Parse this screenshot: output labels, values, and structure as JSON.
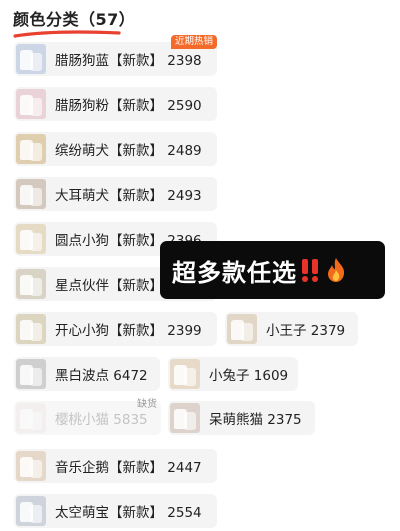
{
  "header": {
    "title": "颜色分类（57）"
  },
  "options": [
    {
      "label": "腊肠狗蓝【新款】 2398",
      "badge": "近期热销",
      "thumb_color": "#cdd6e6"
    },
    {
      "label": "腊肠狗粉【新款】 2590",
      "thumb_color": "#ead3d8"
    },
    {
      "label": "缤纷萌犬【新款】 2489",
      "thumb_color": "#e0cfae"
    },
    {
      "label": "大耳萌犬【新款】 2493",
      "thumb_color": "#d4c9bf"
    },
    {
      "label": "圆点小狗【新款】 2396",
      "thumb_color": "#e6dcc6"
    },
    {
      "label": "星点伙伴【新款】",
      "thumb_color": "#d8d3c4"
    },
    {
      "label": "开心小狗【新款】 2399",
      "thumb_color": "#dcd6c0"
    },
    {
      "label": "小王子 2379",
      "thumb_color": "#e2d6c6"
    },
    {
      "label": "黑白波点 6472",
      "thumb_color": "#cfcfcf"
    },
    {
      "label": "小兔子 1609",
      "thumb_color": "#e7dac8"
    },
    {
      "label": "樱桃小猫 5835",
      "badge_grey": "缺货",
      "thumb_color": "#f0e6e6",
      "disabled": true
    },
    {
      "label": "呆萌熊猫 2375",
      "thumb_color": "#ddd3cc"
    },
    {
      "label": "音乐企鹅【新款】 2447",
      "thumb_color": "#e6d8c8"
    },
    {
      "label": "太空萌宝【新款】 2554",
      "thumb_color": "#cfd4dc"
    }
  ],
  "promo": {
    "text": "超多款任选",
    "icons": [
      "double-exclamation-icon",
      "fire-icon"
    ]
  },
  "colors": {
    "accent": "#f36a2a",
    "underline": "#e8412f",
    "chip_bg": "#f4f4f4",
    "overlay": "#0b0b0b"
  }
}
